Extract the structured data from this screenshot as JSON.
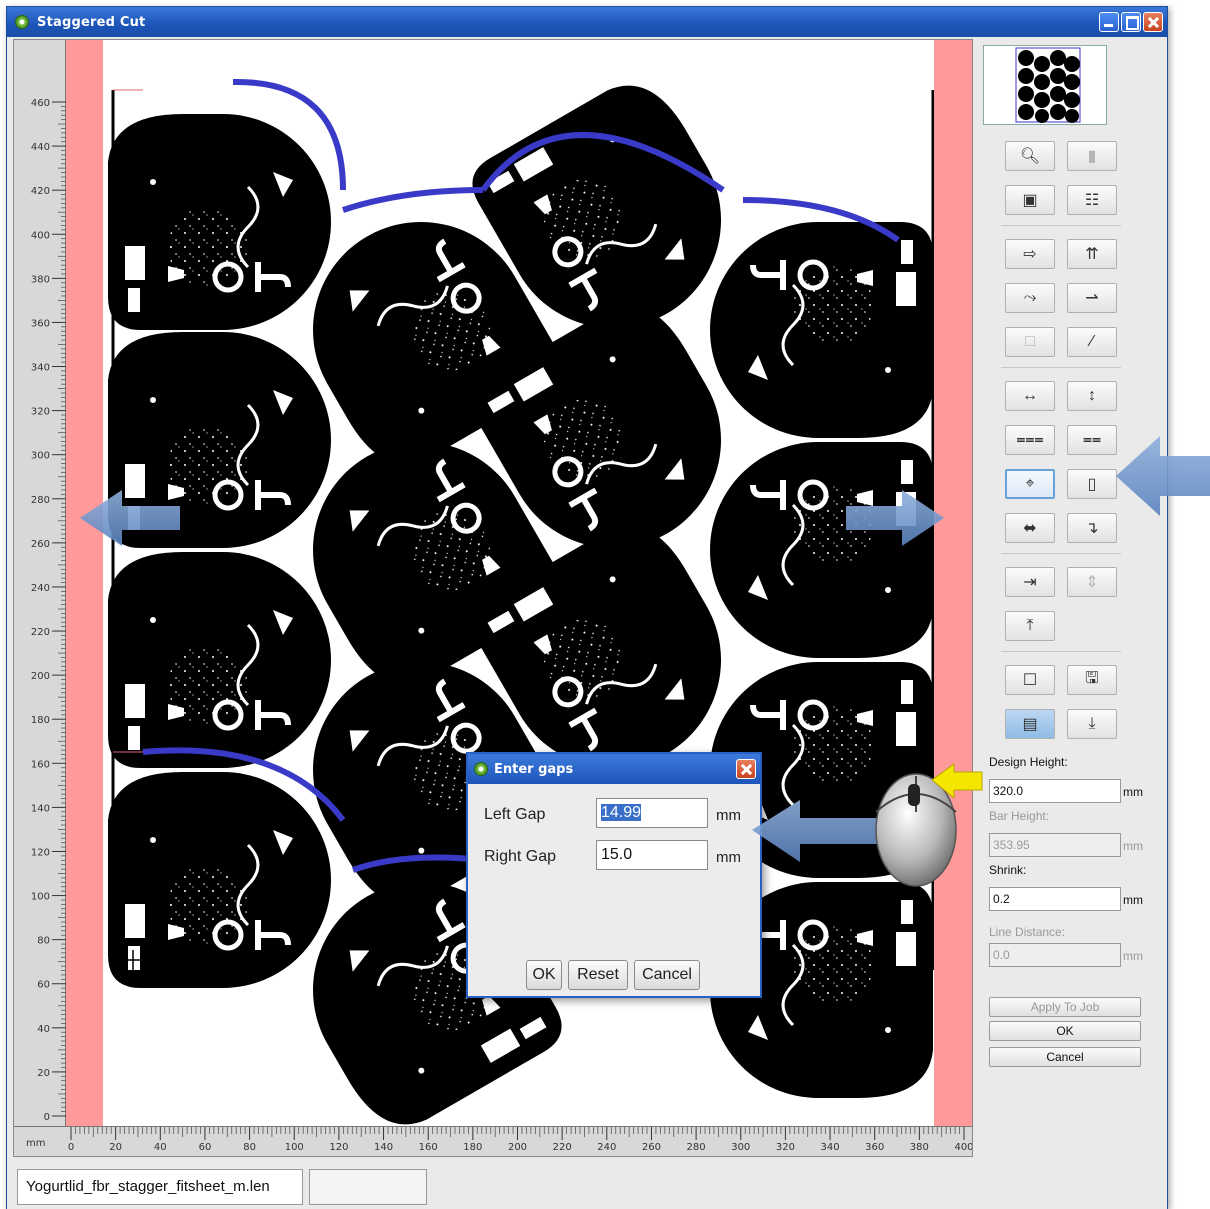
{
  "window": {
    "title": "Staggered Cut"
  },
  "ruler": {
    "unit": "mm",
    "vertical_ticks": [
      "460",
      "440",
      "420",
      "400",
      "380",
      "360",
      "340",
      "320",
      "300",
      "280",
      "260",
      "240",
      "220",
      "200",
      "180",
      "160",
      "140",
      "120",
      "100",
      "80",
      "60",
      "40",
      "20",
      "0"
    ],
    "horizontal_ticks": [
      "0",
      "20",
      "40",
      "60",
      "80",
      "100",
      "120",
      "140",
      "160",
      "180",
      "200",
      "220",
      "240",
      "260",
      "280",
      "300",
      "320",
      "340",
      "360",
      "380",
      "400"
    ]
  },
  "status_bar": {
    "filename": "Yogurtlid_fbr_stagger_fitsheet_m.len"
  },
  "toolbar_icons": [
    "zoom-icon",
    "page-icon",
    "projector-icon",
    "layout-icon",
    "move-right-icon",
    "move-up-icon",
    "rotate-icon",
    "align-right-icon",
    "rectangle-icon",
    "ruler-icon",
    "spread-horizontal-icon",
    "spread-vertical-icon",
    "distribute-top-icon",
    "distribute-bottom-icon",
    "fit-center-icon",
    "frame-icon",
    "center-horizontal-icon",
    "flip-icon",
    "align-left-icon",
    "align-vertical-icon",
    "align-top-icon",
    "new-page-icon",
    "save-icon",
    "stack-icon",
    "download-icon"
  ],
  "side_panel": {
    "design_height_label": "Design Height:",
    "design_height_value": "320.0",
    "bar_height_label": "Bar Height:",
    "bar_height_value": "353.95",
    "shrink_label": "Shrink:",
    "shrink_value": "0.2",
    "line_distance_label": "Line Distance:",
    "line_distance_value": "0.0",
    "unit": "mm",
    "apply_to_job": "Apply To Job",
    "ok": "OK",
    "cancel": "Cancel"
  },
  "dialog": {
    "title": "Enter gaps",
    "left_gap_label": "Left Gap",
    "left_gap_value": "14.99",
    "right_gap_label": "Right Gap",
    "right_gap_value": "15.0",
    "unit": "mm",
    "ok": "OK",
    "reset": "Reset",
    "cancel": "Cancel"
  },
  "colors": {
    "title_bar": "#1c54b8",
    "margin": "#ff9a9a",
    "label_fill": "#000000",
    "cut_outline": "#3a3ac8",
    "callout_arrow": "#6f94c8",
    "mouse_arrow": "#f5e600"
  }
}
